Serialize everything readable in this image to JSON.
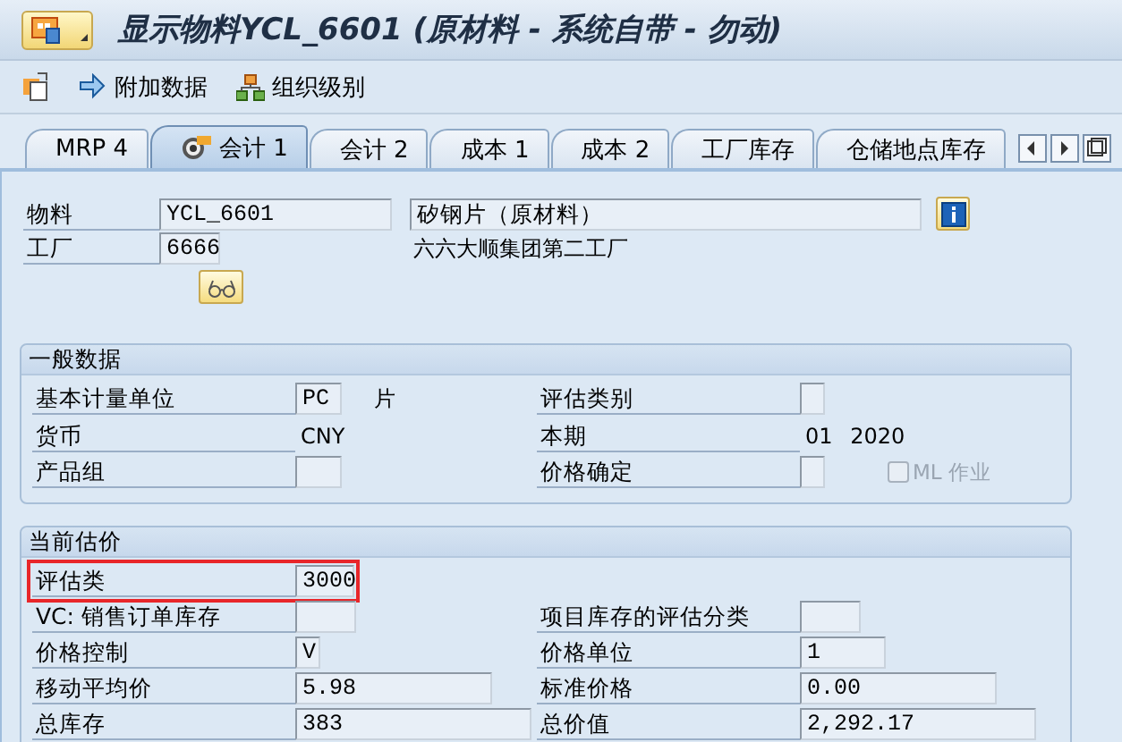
{
  "window": {
    "title": "显示物料YCL_6601 (原材料 - 系统自带 - 勿动)"
  },
  "toolbar": [
    {
      "label": "附加数据",
      "kind": "arrow"
    },
    {
      "label": "组织级别",
      "kind": "org"
    }
  ],
  "tabs": [
    {
      "label": "MRP 4",
      "selected": false
    },
    {
      "label": "会计 1",
      "selected": true
    },
    {
      "label": "会计 2",
      "selected": false
    },
    {
      "label": "成本 1",
      "selected": false
    },
    {
      "label": "成本 2",
      "selected": false
    },
    {
      "label": "工厂库存",
      "selected": false
    },
    {
      "label": "仓储地点库存",
      "selected": false
    }
  ],
  "header": {
    "material_label": "物料",
    "material": "YCL_6601",
    "material_description": "矽钢片（原材料）",
    "plant_label": "工厂",
    "plant": "6666",
    "plant_name": "六六大顺集团第二工厂"
  },
  "groups": [
    {
      "title": "一般数据",
      "rows": [
        {
          "highlighted": false,
          "left": {
            "label": "基本计量单位",
            "value": "PC",
            "kind": "field",
            "unit": "片"
          },
          "right": {
            "label": "评估类别",
            "kind": "field"
          }
        },
        {
          "highlighted": false,
          "left": {
            "label": "货币",
            "value": "CNY",
            "kind": "text"
          },
          "right": {
            "label": "本期",
            "value": "01 2020",
            "kind": "text"
          }
        },
        {
          "highlighted": false,
          "left": {
            "label": "产品组",
            "kind": "field"
          },
          "right": {
            "label": "价格确定",
            "kind": "field"
          },
          "checkbox": {
            "label": "ML 作业",
            "checked": false,
            "disabled": true
          }
        }
      ]
    },
    {
      "title": "当前估价",
      "rows": [
        {
          "highlighted": true,
          "left": {
            "label": "评估类",
            "value": "3000",
            "kind": "field"
          }
        },
        {
          "highlighted": false,
          "left": {
            "label": "VC: 销售订单库存",
            "kind": "field"
          },
          "right": {
            "label": "项目库存的评估分类",
            "kind": "field"
          }
        },
        {
          "highlighted": false,
          "left": {
            "label": "价格控制",
            "value": "V",
            "kind": "field"
          },
          "right": {
            "label": "价格单位",
            "value": "1",
            "kind": "field"
          }
        },
        {
          "highlighted": false,
          "left": {
            "label": "移动平均价",
            "value": "5.98",
            "kind": "field"
          },
          "right": {
            "label": "标准价格",
            "value": "0.00",
            "kind": "field"
          }
        },
        {
          "highlighted": false,
          "left": {
            "label": "总库存",
            "value": "383",
            "kind": "field"
          },
          "right": {
            "label": "总价值",
            "value": "2,292.17",
            "kind": "field"
          }
        }
      ]
    }
  ]
}
